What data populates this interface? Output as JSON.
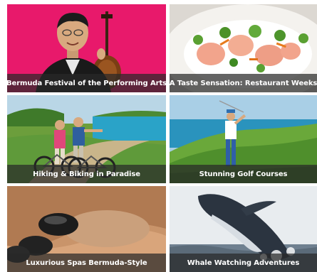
{
  "tiles": [
    {
      "title": "Bermuda Festival of the Performing Arts",
      "image": "cellist-portrait"
    },
    {
      "title": "A Taste Sensation: Restaurant Weeks",
      "image": "gourmet-plate"
    },
    {
      "title": "Hiking & Biking in Paradise",
      "image": "cyclists-coast"
    },
    {
      "title": "Stunning Golf Courses",
      "image": "golfer-cliff"
    },
    {
      "title": "Luxurious Spas Bermuda-Style",
      "image": "spa-stones"
    },
    {
      "title": "Whale Watching Adventures",
      "image": "breaching-whale"
    }
  ],
  "colors": {
    "festival_bg": "#e8196b",
    "caption_bg": "#282828",
    "sea": "#2aa3c8",
    "grass": "#5f9a3a"
  }
}
